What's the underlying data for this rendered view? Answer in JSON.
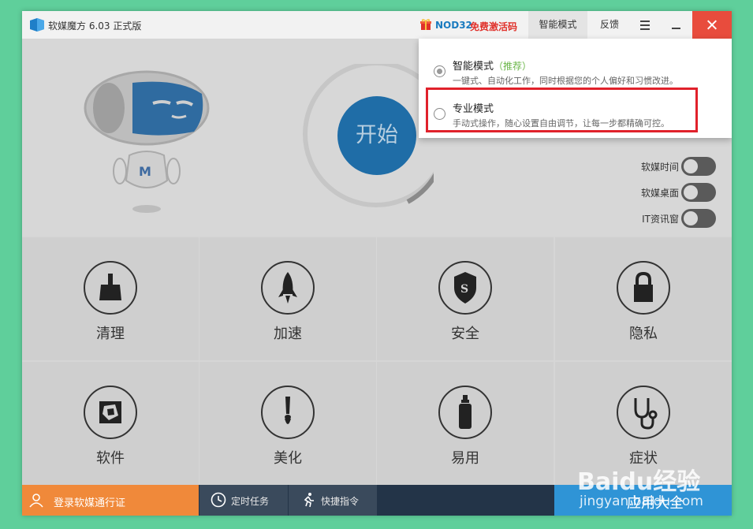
{
  "window": {
    "title": "软媒魔方 6.03 正式版"
  },
  "titlebar": {
    "promo_brand": "NOD32",
    "promo_offer": "免费激活码",
    "mode_label": "智能模式",
    "feedback_label": "反馈"
  },
  "main": {
    "start_label": "开始",
    "toggles": [
      {
        "label": "软媒时间",
        "on": false
      },
      {
        "label": "软媒桌面",
        "on": false
      },
      {
        "label": "IT资讯窗",
        "on": false
      }
    ]
  },
  "tiles": [
    {
      "label": "清理",
      "icon": "broom-icon"
    },
    {
      "label": "加速",
      "icon": "rocket-icon"
    },
    {
      "label": "安全",
      "icon": "shield-icon"
    },
    {
      "label": "隐私",
      "icon": "lock-icon"
    },
    {
      "label": "软件",
      "icon": "aperture-icon"
    },
    {
      "label": "美化",
      "icon": "brush-icon"
    },
    {
      "label": "易用",
      "icon": "bottle-icon"
    },
    {
      "label": "症状",
      "icon": "stethoscope-icon"
    }
  ],
  "bottombar": {
    "login_label": "登录软媒通行证",
    "scheduled_label": "定时任务",
    "shortcut_label": "快捷指令",
    "apps_label": "应用大全"
  },
  "mode_dropdown": {
    "options": [
      {
        "title": "智能模式",
        "tag": "（推荐）",
        "desc": "一键式、自动化工作，同时根据您的个人偏好和习惯改进。",
        "selected": true
      },
      {
        "title": "专业模式",
        "tag": "",
        "desc": "手动式操作，随心设置自由调节，让每一步都精确可控。",
        "selected": false
      }
    ]
  },
  "watermark": {
    "line1": "Baidu经验",
    "line2": "jingyan.baidu.com"
  },
  "colors": {
    "close_red": "#e84c3d",
    "start_blue": "#1f6da7",
    "login_orange": "#f0893a",
    "apps_blue": "#2f94d6",
    "highlight_red": "#e0212b",
    "recommend_green": "#6ab648"
  }
}
